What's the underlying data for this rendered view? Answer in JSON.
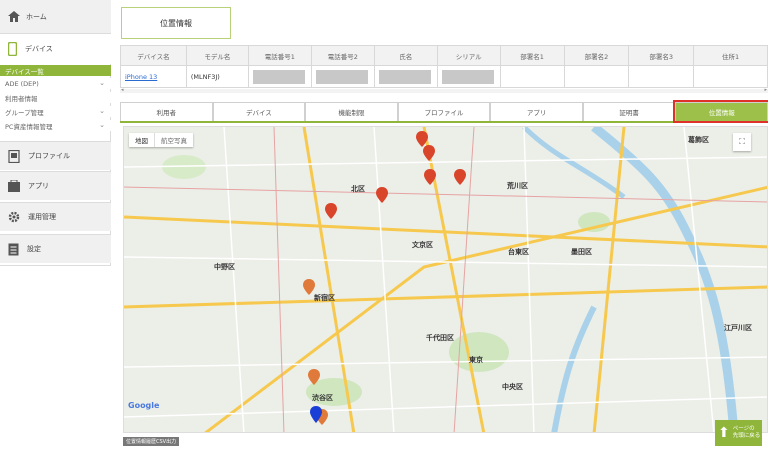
{
  "sidebar": {
    "home": "ホーム",
    "device": "デバイス",
    "device_sub": [
      "デバイス一覧",
      "ADE (DEP)",
      "利用者情報",
      "グループ管理",
      "PC資産情報管理"
    ],
    "profile": "プロファイル",
    "apps": "アプリ",
    "ops": "運用管理",
    "settings": "設定"
  },
  "page_title": "位置情報",
  "table": {
    "headers": [
      "デバイス名",
      "モデル名",
      "電話番号1",
      "電話番号2",
      "氏名",
      "シリアル",
      "部署名1",
      "部署名2",
      "部署名3",
      "住所1"
    ],
    "row": {
      "device_name": "iPhone 13",
      "model": "(MLNF3J)"
    }
  },
  "tabs": [
    "利用者",
    "デバイス",
    "機能制限",
    "プロファイル",
    "アプリ",
    "証明書",
    "位置情報"
  ],
  "map": {
    "type_map": "地図",
    "type_satellite": "航空写真",
    "labels": {
      "katsushika": "葛飾区",
      "arakawa": "荒川区",
      "kita": "北区",
      "bunkyo": "文京区",
      "taito": "台東区",
      "sumida": "墨田区",
      "nakano": "中野区",
      "shinjuku": "新宿区",
      "chiyoda": "千代田区",
      "edogawa": "江戸川区",
      "chuo": "中央区",
      "shibuya": "渋谷区",
      "tokyo": "東京"
    },
    "google": "Google"
  },
  "csv_export": "位置情報履歴CSV出力",
  "page_top": [
    "ページの",
    "先頭に戻る"
  ],
  "colors": {
    "accent": "#8fb63a",
    "highlight": "#e0302a",
    "pin_red": "#d9452b",
    "pin_orange": "#e07a3a",
    "pin_blue": "#1a3fd6"
  }
}
